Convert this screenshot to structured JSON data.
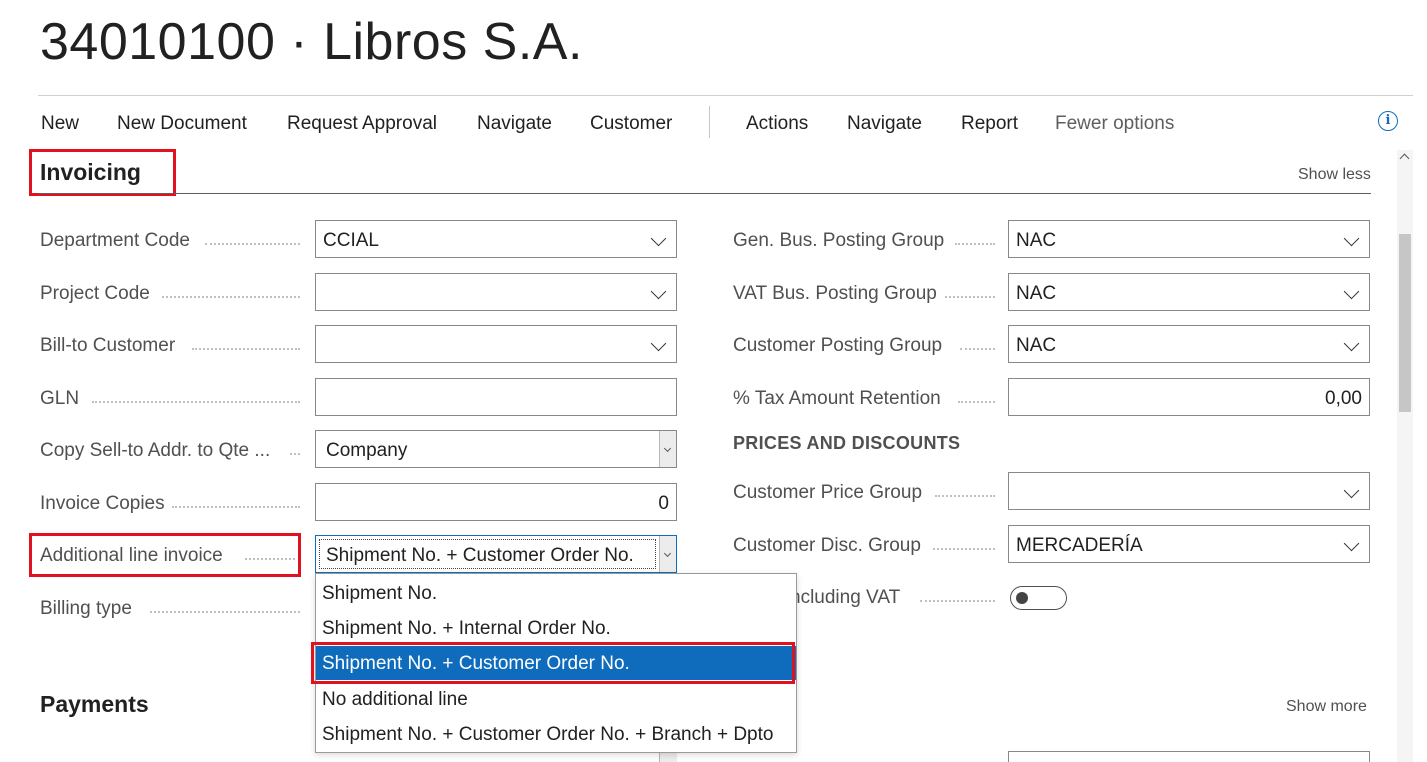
{
  "page": {
    "title": "34010100 · Libros S.A."
  },
  "action_bar": {
    "items": [
      "New",
      "New Document",
      "Request Approval",
      "Navigate",
      "Customer"
    ],
    "items2": [
      "Actions",
      "Navigate",
      "Report"
    ],
    "fewer_options": "Fewer options",
    "info_icon": "info-icon"
  },
  "invoicing": {
    "title": "Invoicing",
    "show_less": "Show less",
    "left": {
      "department_code": {
        "label": "Department Code",
        "value": "CCIAL"
      },
      "project_code": {
        "label": "Project Code",
        "value": ""
      },
      "bill_to_customer": {
        "label": "Bill-to Customer",
        "value": ""
      },
      "gln": {
        "label": "GLN",
        "value": ""
      },
      "copy_sell_to": {
        "label": "Copy Sell-to Addr. to Qte ...",
        "value": "Company"
      },
      "invoice_copies": {
        "label": "Invoice Copies",
        "value": "0"
      },
      "additional_line_invoice": {
        "label": "Additional line invoice",
        "value": "Shipment No. + Customer Order No."
      },
      "billing_type": {
        "label": "Billing type"
      }
    },
    "right": {
      "gen_bus_posting_group": {
        "label": "Gen. Bus. Posting Group",
        "value": "NAC"
      },
      "vat_bus_posting_group": {
        "label": "VAT Bus. Posting Group",
        "value": "NAC"
      },
      "customer_posting_group": {
        "label": "Customer Posting Group",
        "value": "NAC"
      },
      "tax_amount_retention": {
        "label": "% Tax Amount Retention",
        "value": "0,00"
      },
      "prices_and_discounts": "PRICES AND DISCOUNTS",
      "customer_price_group": {
        "label": "Customer Price Group",
        "value": ""
      },
      "customer_disc_group": {
        "label": "Customer Disc. Group",
        "value": "MERCADERÍA"
      },
      "prices_including_vat": {
        "label": "ncluding VAT",
        "checked": false
      }
    }
  },
  "dropdown": {
    "options": [
      "Shipment No.",
      "Shipment No. + Internal Order No.",
      "Shipment No. + Customer Order No.",
      "No additional line",
      "Shipment No. + Customer Order No. + Branch + Dpto"
    ],
    "selected_index": 2,
    "highlight_color": "#0f6cbd"
  },
  "payments": {
    "title": "Payments",
    "show_more": "Show more"
  },
  "colors": {
    "annotation_red": "#e0121f",
    "accent": "#0f6cbd"
  }
}
